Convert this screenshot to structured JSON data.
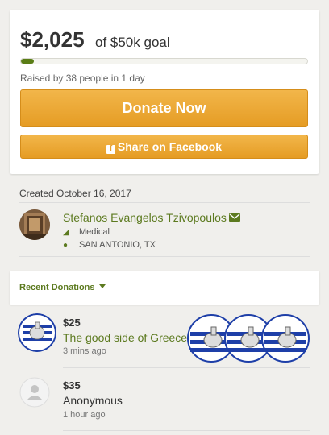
{
  "campaign": {
    "amount_raised": "$2,025",
    "goal_text": "of $50k goal",
    "progress_fraction": 0.0405,
    "raised_by_text": "Raised by 38 people in 1 day",
    "donate_label": "Donate Now",
    "share_label": "Share on Facebook"
  },
  "info": {
    "created": "Created October 16, 2017",
    "organizer_name": "Stefanos Evangelos Tzivopoulos",
    "category": "Medical",
    "location": "SAN ANTONIO, TX"
  },
  "recent": {
    "label": "Recent Donations"
  },
  "donations": [
    {
      "amount": "$25",
      "name": "The good side of Greece",
      "time": "3 mins ago"
    },
    {
      "amount": "$35",
      "name": "Anonymous",
      "time": "1 hour ago"
    }
  ],
  "colors": {
    "accent_green": "#5c7a1f",
    "button_orange": "#e8a02c"
  }
}
